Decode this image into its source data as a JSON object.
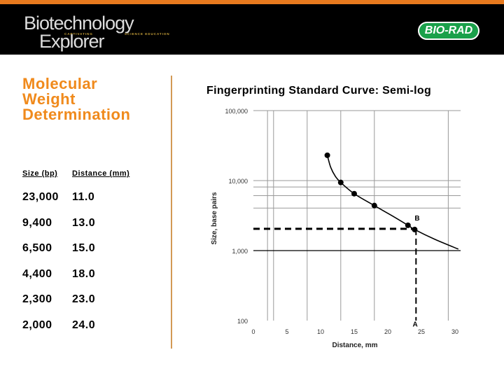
{
  "header": {
    "logo_line1": "Biotechnology",
    "logo_line2": "Explorer",
    "tagline_left": "CAPTIVATING",
    "tagline_right": "SCIENCE EDUCATION",
    "brand": "BIO-RAD",
    "accent_color": "#e87a1e",
    "brand_color": "#1aa04a"
  },
  "slide_title": [
    "Molecular",
    "Weight",
    "Determination"
  ],
  "table": {
    "headers": [
      "Size (bp)",
      "Distance (mm)"
    ],
    "rows": [
      [
        "23,000",
        "11.0"
      ],
      [
        "9,400",
        "13.0"
      ],
      [
        "6,500",
        "15.0"
      ],
      [
        "4,400",
        "18.0"
      ],
      [
        "2,300",
        "23.0"
      ],
      [
        "2,000",
        "24.0"
      ]
    ]
  },
  "chart_data": {
    "type": "scatter",
    "title": "Fingerprinting Standard Curve:  Semi-log",
    "xlabel": "Distance, mm",
    "ylabel": "Size, base pairs",
    "xlim": [
      0,
      30
    ],
    "ylim": [
      100,
      100000
    ],
    "y_scale": "log",
    "x_ticks": [
      "0",
      "5",
      "10",
      "15",
      "20",
      "25",
      "30"
    ],
    "y_ticks": [
      "100",
      "1,000",
      "10,000",
      "100,000"
    ],
    "grid": true,
    "points": [
      {
        "x": 11,
        "y": 23000
      },
      {
        "x": 13,
        "y": 9400
      },
      {
        "x": 15,
        "y": 6500
      },
      {
        "x": 18,
        "y": 4400
      },
      {
        "x": 23,
        "y": 2300
      },
      {
        "x": 24,
        "y": 2000
      }
    ],
    "curve": [
      [
        11,
        23000
      ],
      [
        11.5,
        15500
      ],
      [
        12.2,
        11500
      ],
      [
        13,
        9400
      ],
      [
        15,
        6500
      ],
      [
        18,
        4400
      ],
      [
        20.5,
        3200
      ],
      [
        23,
        2300
      ],
      [
        24,
        2000
      ],
      [
        27,
        1450
      ],
      [
        30.5,
        1050
      ]
    ],
    "reference_line": {
      "x": 24.2,
      "y": 2050
    },
    "annotations": [
      {
        "text": "B",
        "x": 24,
        "y": 2700
      },
      {
        "text": "A",
        "x": 23.7,
        "y": 82
      }
    ]
  }
}
